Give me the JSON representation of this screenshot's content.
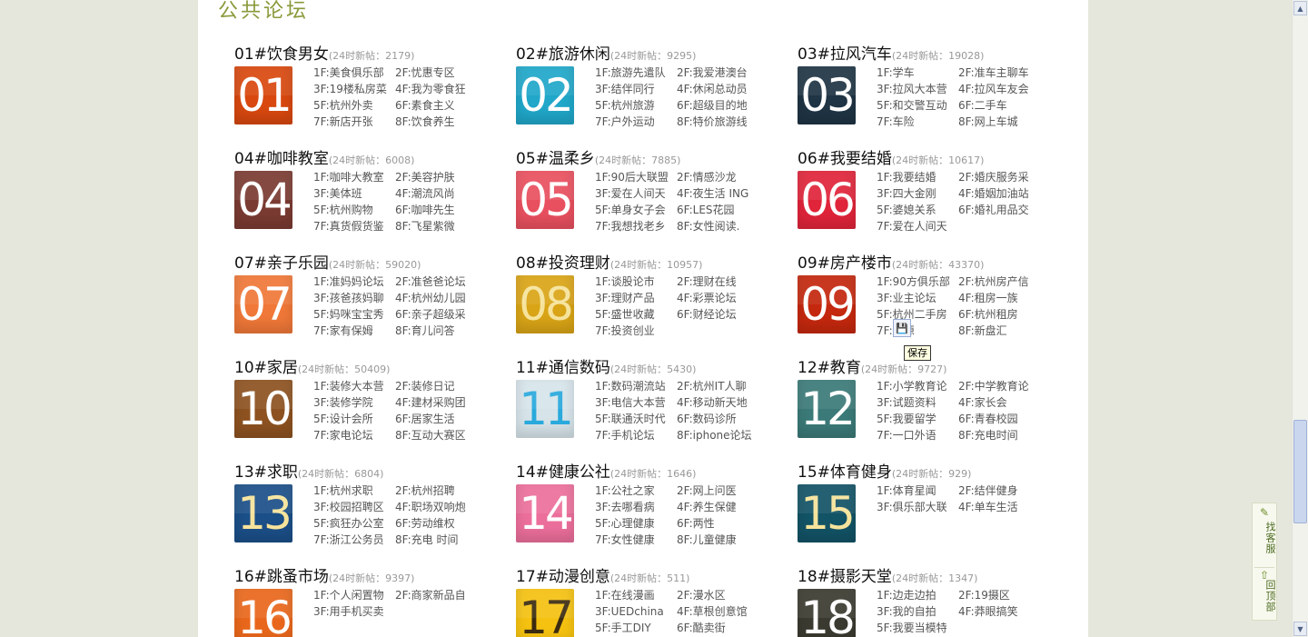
{
  "section_title": "公共论坛",
  "tooltip": "保存",
  "side_widget": {
    "service": "找客服",
    "top": "回顶部"
  },
  "forums": [
    {
      "title": "01#饮食男女",
      "count": "(24时新帖：2179)",
      "num": "01",
      "color": "#d8480f",
      "subs": [
        "1F:美食俱乐部",
        "2F:忧惠专区",
        "3F:19楼私房菜",
        "4F:我为零食狂",
        "5F:杭州外卖",
        "6F:素食主义",
        "7F:新店开张",
        "8F:饮食养生"
      ]
    },
    {
      "title": "02#旅游休闲",
      "count": "(24时新帖：9295)",
      "num": "02",
      "color": "#20a7c9",
      "subs": [
        "1F:旅游先遣队",
        "2F:我爱港澳台",
        "3F:结伴同行",
        "4F:休闲总动员",
        "5F:杭州旅游",
        "6F:超级目的地",
        "7F:户外运动",
        "8F:特价旅游线"
      ]
    },
    {
      "title": "03#拉风汽车",
      "count": "(24时新帖：19028)",
      "num": "03",
      "color": "#1f3444",
      "subs": [
        "1F:学车",
        "2F:准车主聊车",
        "3F:拉风大本营",
        "4F:拉风车友会",
        "5F:和交警互动",
        "6F:二手车",
        "7F:车险",
        "8F:网上车城"
      ]
    },
    {
      "title": "04#咖啡教室",
      "count": "(24时新帖：6008)",
      "num": "04",
      "color": "#7a3b32",
      "subs": [
        "1F:咖啡大教室",
        "2F:美容护肤",
        "3F:美体班",
        "4F:潮流风尚",
        "5F:杭州购物",
        "6F:咖啡先生",
        "7F:真货假货鉴",
        "8F:飞星紫微"
      ]
    },
    {
      "title": "05#温柔乡",
      "count": "(24时新帖：7885)",
      "num": "05",
      "color": "#e9505f",
      "subs": [
        "1F:90后大联盟",
        "2F:情感沙龙",
        "3F:爱在人间天",
        "4F:夜生活 ING",
        "5F:单身女子会",
        "6F:LES花园",
        "7F:我想找老乡",
        "8F:女性阅读."
      ]
    },
    {
      "title": "06#我要结婚",
      "count": "(24时新帖：10617)",
      "num": "06",
      "color": "#e0243a",
      "subs": [
        "1F:我要结婚",
        "2F:婚庆服务采",
        "3F:四大金刚",
        "4F:婚姻加油站",
        "5F:婆媳关系",
        "6F:婚礼用品交",
        "7F:爱在人间天"
      ]
    },
    {
      "title": "07#亲子乐园",
      "count": "(24时新帖：59020)",
      "num": "07",
      "color": "#f07838",
      "subs": [
        "1F:准妈妈论坛",
        "2F:准爸爸论坛",
        "3F:孩爸孩妈聊",
        "4F:杭州幼儿园",
        "5F:妈咪宝宝秀",
        "6F:亲子超级采",
        "7F:家有保姆",
        "8F:育儿问答"
      ]
    },
    {
      "title": "08#投资理财",
      "count": "(24时新帖：10957)",
      "num": "08",
      "color": "#d9a416",
      "subs": [
        "1F:谈股论市",
        "2F:理财在线",
        "3F:理财产品",
        "4F:彩票论坛",
        "5F:盛世收藏",
        "6F:财经论坛",
        "7F:投资创业"
      ]
    },
    {
      "title": "09#房产楼市",
      "count": "(24时新帖：43370)",
      "num": "09",
      "color": "#c4280e",
      "subs": [
        "1F:90方俱乐部",
        "2F:杭州房产信",
        "3F:业主论坛",
        "4F:租房一族",
        "5F:杭州二手房",
        "6F:杭州租房",
        "7F:房源",
        "8F:新盘汇"
      ]
    },
    {
      "title": "10#家居",
      "count": "(24时新帖：50409)",
      "num": "10",
      "color": "#8d5220",
      "subs": [
        "1F:装修大本营",
        "2F:装修日记",
        "3F:装修学院",
        "4F:建材采购团",
        "5F:设计会所",
        "6F:居家生活",
        "7F:家电论坛",
        "8F:互动大赛区"
      ]
    },
    {
      "title": "11#通信数码",
      "count": "(24时新帖：5430)",
      "num": "11",
      "color": "#d6e4ea",
      "subs": [
        "1F:数码潮流站",
        "2F:杭州IT人聊",
        "3F:电信大本营",
        "4F:移动新天地",
        "5F:联通沃时代",
        "6F:数码诊所",
        "7F:手机论坛",
        "8F:iphone论坛"
      ]
    },
    {
      "title": "12#教育",
      "count": "(24时新帖：9727)",
      "num": "12",
      "color": "#3b7a78",
      "subs": [
        "1F:小学教育论",
        "2F:中学教育论",
        "3F:试题资料",
        "4F:家长会",
        "5F:我要留学",
        "6F:青春校园",
        "7F:一口外语",
        "8F:充电时间"
      ]
    },
    {
      "title": "13#求职",
      "count": "(24时新帖：6804)",
      "num": "13",
      "color": "#1b4f88",
      "subs": [
        "1F:杭州求职",
        "2F:杭州招聘",
        "3F:校园招聘区",
        "4F:职场双响炮",
        "5F:疯狂办公室",
        "6F:劳动维权",
        "7F:浙江公务员",
        "8F:充电 时间"
      ]
    },
    {
      "title": "14#健康公社",
      "count": "(24时新帖：1646)",
      "num": "14",
      "color": "#ec6f9b",
      "subs": [
        "1F:公社之家",
        "2F:网上问医",
        "3F:去哪看病",
        "4F:养生保健",
        "5F:心理健康",
        "6F:两性",
        "7F:女性健康",
        "8F:儿童健康"
      ]
    },
    {
      "title": "15#体育健身",
      "count": "(24时新帖：929)",
      "num": "15",
      "color": "#125366",
      "subs": [
        "1F:体育星闻",
        "2F:结伴健身",
        "3F:俱乐部大联",
        "4F:单车生活"
      ]
    },
    {
      "title": "16#跳蚤市场",
      "count": "(24时新帖：9397)",
      "num": "16",
      "color": "#e9671c",
      "subs": [
        "1F:个人闲置物",
        "2F:商家新品自",
        "3F:用手机买卖"
      ]
    },
    {
      "title": "17#动漫创意",
      "count": "(24时新帖：511)",
      "num": "17",
      "color": "#f5c211",
      "subs": [
        "1F:在线漫画",
        "2F:漫水区",
        "3F:UEDchina",
        "4F:草根创意馆",
        "5F:手工DIY",
        "6F:酷卖街"
      ]
    },
    {
      "title": "18#摄影天堂",
      "count": "(24时新帖：1347)",
      "num": "18",
      "color": "#3a3a30",
      "subs": [
        "1F:边走边拍",
        "2F:19摄区",
        "3F:我的自拍",
        "4F:莽眼搞笑",
        "5F:我要当模特"
      ]
    }
  ]
}
